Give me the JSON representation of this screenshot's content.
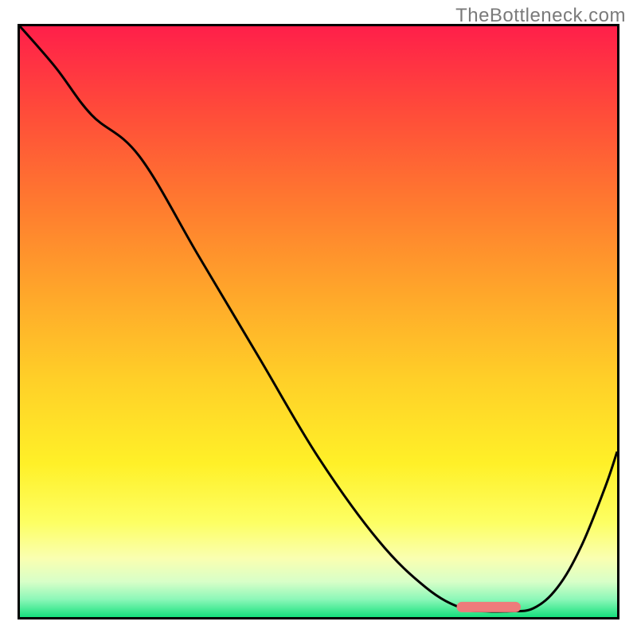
{
  "watermark": "TheBottleneck.com",
  "chart_data": {
    "type": "line",
    "title": "",
    "xlabel": "",
    "ylabel": "",
    "xlim": [
      0,
      100
    ],
    "ylim": [
      0,
      100
    ],
    "grid": false,
    "legend": false,
    "series": [
      {
        "name": "curve",
        "color": "#000000",
        "x": [
          0,
          6,
          12,
          20,
          30,
          40,
          50,
          60,
          68,
          74,
          78,
          82,
          86,
          90,
          94,
          98,
          100
        ],
        "y": [
          100,
          93,
          85,
          78,
          61,
          44,
          27,
          13,
          5,
          1.5,
          1,
          1,
          1.5,
          5,
          12,
          22,
          28
        ]
      },
      {
        "name": "marker",
        "type": "segment",
        "color": "#ee7b7b",
        "x": [
          74,
          83
        ],
        "y": [
          1.7,
          1.7
        ]
      }
    ],
    "background_gradient": {
      "stops": [
        {
          "offset": 0.0,
          "color": "#ff1f4a"
        },
        {
          "offset": 0.14,
          "color": "#ff4a3a"
        },
        {
          "offset": 0.3,
          "color": "#ff7a2f"
        },
        {
          "offset": 0.46,
          "color": "#ffa92a"
        },
        {
          "offset": 0.6,
          "color": "#ffd028"
        },
        {
          "offset": 0.74,
          "color": "#fff028"
        },
        {
          "offset": 0.84,
          "color": "#fdff63"
        },
        {
          "offset": 0.9,
          "color": "#faffb0"
        },
        {
          "offset": 0.94,
          "color": "#d8ffc8"
        },
        {
          "offset": 0.97,
          "color": "#8cf7b8"
        },
        {
          "offset": 1.0,
          "color": "#16e07d"
        }
      ]
    }
  }
}
